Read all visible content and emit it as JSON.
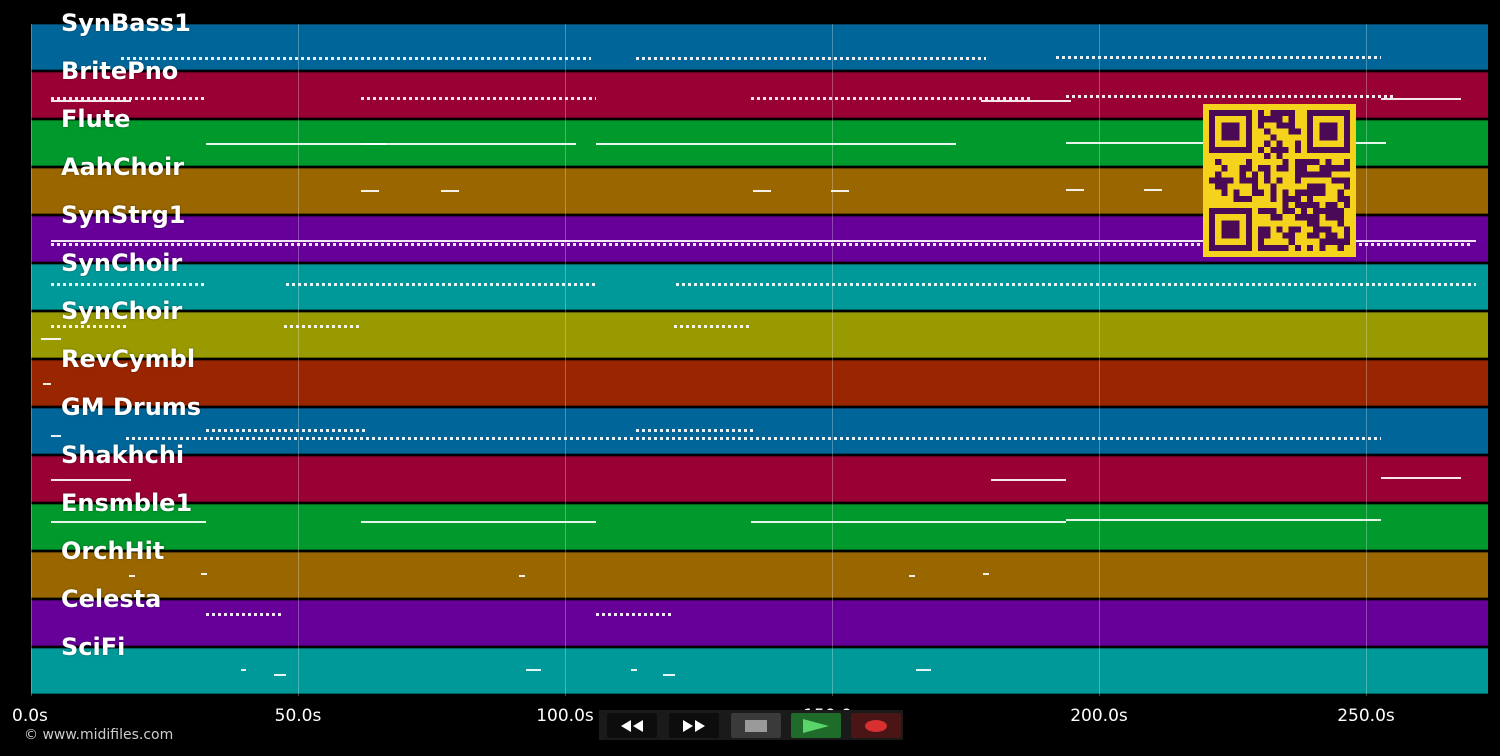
{
  "tracks": [
    {
      "name": "SynBass1",
      "color": "#006699"
    },
    {
      "name": "BritePno",
      "color": "#990033"
    },
    {
      "name": "Flute",
      "color": "#00992b"
    },
    {
      "name": "AahChoir",
      "color": "#996600"
    },
    {
      "name": "SynStrg1",
      "color": "#660099"
    },
    {
      "name": "SynChoir",
      "color": "#009999"
    },
    {
      "name": "SynChoir",
      "color": "#999900"
    },
    {
      "name": "RevCymbl",
      "color": "#992600"
    },
    {
      "name": "GM Drums",
      "color": "#006699"
    },
    {
      "name": "Shakhchi",
      "color": "#990033"
    },
    {
      "name": "Ensmble1",
      "color": "#00992b"
    },
    {
      "name": "OrchHit",
      "color": "#996600"
    },
    {
      "name": "Celesta",
      "color": "#660099"
    },
    {
      "name": "SciFi",
      "color": "#009999"
    }
  ],
  "timeline": {
    "ticks": [
      "0.0s",
      "50.0s",
      "100.0s",
      "150.0s",
      "200.0s",
      "250.0s"
    ],
    "total_seconds": 273
  },
  "copyright": "© www.midifiles.com",
  "transport": {
    "rewind_icon": "rewind-icon",
    "fast_forward_icon": "fast-forward-icon",
    "stop_icon": "stop-icon",
    "play_icon": "play-icon",
    "record_icon": "record-icon"
  },
  "qr_code": {
    "color_fg": "#4a0a55",
    "color_bg": "#f5d31d"
  }
}
